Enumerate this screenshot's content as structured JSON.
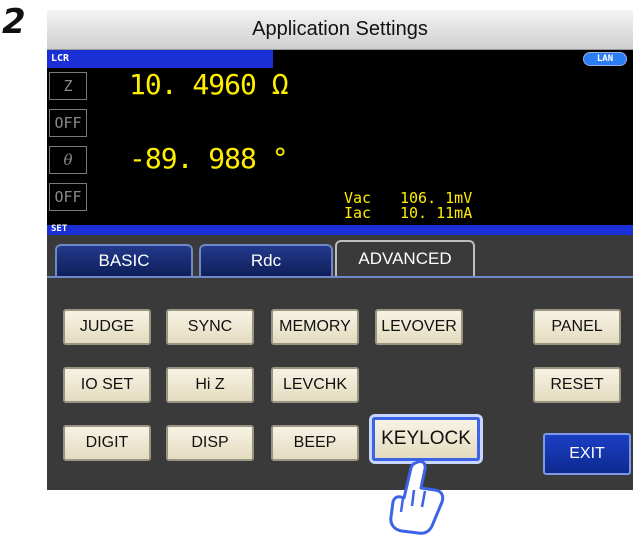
{
  "step_number": "2",
  "window": {
    "title": "Application Settings"
  },
  "status": {
    "lcr_label": "LCR",
    "lan_badge": "LAN",
    "set_label": "SET"
  },
  "measurement": {
    "param1": "Z",
    "param1_value": "10. 4960 Ω",
    "param2": "OFF",
    "param3": "θ",
    "param3_value": "-89. 988 °",
    "param4": "OFF",
    "vac_label": "Vac",
    "vac_value": "106. 1mV",
    "iac_label": "Iac",
    "iac_value": "10. 11mA"
  },
  "tabs": [
    {
      "label": "BASIC",
      "active": false
    },
    {
      "label": "Rdc",
      "active": false
    },
    {
      "label": "ADVANCED",
      "active": true
    }
  ],
  "buttons": {
    "judge": "JUDGE",
    "sync": "SYNC",
    "memory": "MEMORY",
    "levover": "LEVOVER",
    "panel": "PANEL",
    "io_set": "IO SET",
    "hi_z": "Hi Z",
    "levchk": "LEVCHK",
    "reset": "RESET",
    "digit": "DIGIT",
    "disp": "DISP",
    "beep": "BEEP",
    "keylock": "KEYLOCK",
    "exit": "EXIT"
  },
  "colors": {
    "accent_blue": "#1a2fd6",
    "value_yellow": "#ffee00",
    "highlight": "#3d63e8"
  },
  "icons": {
    "pointer": "hand-pointer-icon"
  }
}
